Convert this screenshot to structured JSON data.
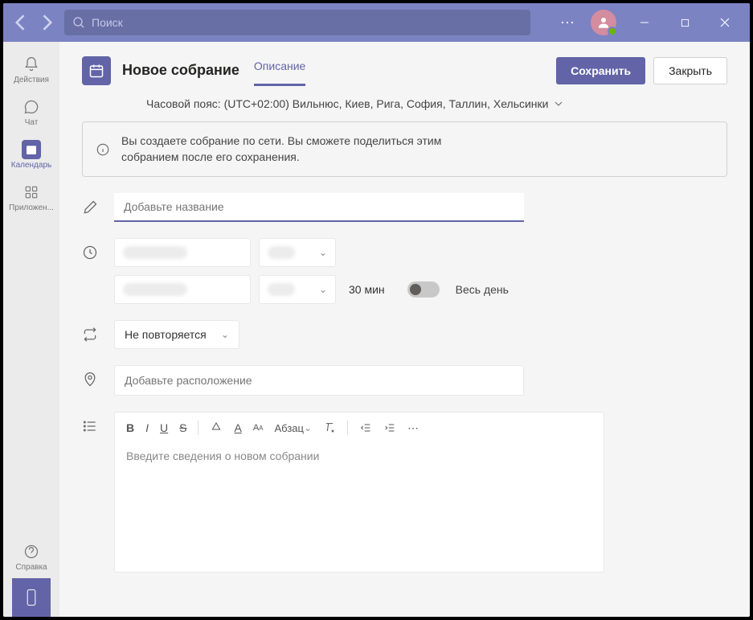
{
  "search": {
    "placeholder": "Поиск"
  },
  "sidebar": {
    "items": [
      {
        "label": "Действия"
      },
      {
        "label": "Чат"
      },
      {
        "label": "Календарь"
      },
      {
        "label": "Приложен..."
      }
    ],
    "help": "Справка"
  },
  "header": {
    "title": "Новое собрание",
    "tabs": [
      {
        "label": "Описание"
      }
    ],
    "save": "Сохранить",
    "close": "Закрыть"
  },
  "timezone": "Часовой пояс: (UTC+02:00) Вильнюс, Киев, Рига, София, Таллин, Хельсинки",
  "info": "Вы создаете собрание по сети. Вы сможете поделиться этим собранием после его сохранения.",
  "form": {
    "title_placeholder": "Добавьте название",
    "duration": "30 мин",
    "all_day": "Весь день",
    "repeat": "Не повторяется",
    "location_placeholder": "Добавьте расположение",
    "paragraph": "Абзац",
    "details_placeholder": "Введите сведения о новом собрании"
  }
}
